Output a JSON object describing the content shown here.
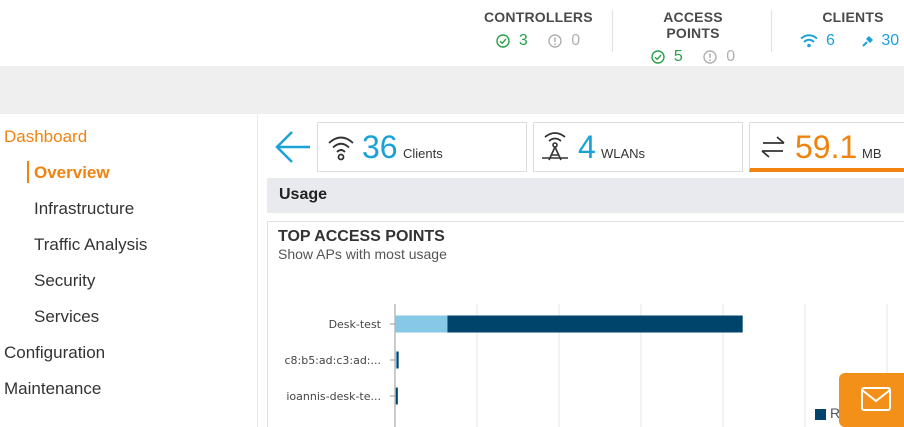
{
  "header": {
    "controllers": {
      "title": "CONTROLLERS",
      "ok": "3",
      "down": "0"
    },
    "access_points": {
      "title": "ACCESS POINTS",
      "ok": "5",
      "down": "0"
    },
    "clients": {
      "title": "CLIENTS",
      "wireless": "6",
      "wired": "30"
    }
  },
  "sidebar": {
    "items": [
      {
        "label": "Dashboard",
        "state": "section-active"
      },
      {
        "label": "Overview",
        "state": "active"
      },
      {
        "label": "Infrastructure"
      },
      {
        "label": "Traffic Analysis"
      },
      {
        "label": "Security"
      },
      {
        "label": "Services"
      },
      {
        "label": "Configuration"
      },
      {
        "label": "Maintenance"
      }
    ]
  },
  "tiles": [
    {
      "value": "36",
      "unit": "Clients",
      "icon": "wifi-icon"
    },
    {
      "value": "4",
      "unit": "WLANs",
      "icon": "access-point-icon"
    },
    {
      "value": "59.1",
      "unit": "MB",
      "icon": "transfer-arrows-icon",
      "selected": true
    }
  ],
  "usage": {
    "label": "Usage"
  },
  "panel": {
    "title": "TOP ACCESS POINTS",
    "subtitle": "Show APs with most usage"
  },
  "chart_data": {
    "type": "bar",
    "orientation": "horizontal",
    "stacked": true,
    "categories": [
      "Desk-test",
      "c8:b5:ad:c3:ad:...",
      "ioannis-desk-te..."
    ],
    "series": [
      {
        "values": [
          3.2,
          0.1,
          0.05
        ],
        "color": "#87c7e8"
      },
      {
        "values": [
          18.0,
          0.05,
          0.1
        ],
        "color": "#00436b"
      }
    ],
    "xlim": [
      0,
      30
    ],
    "grid": true,
    "legend_text": "R"
  },
  "colors": {
    "accent": "#f0830f",
    "brand_blue": "#1aa2d8",
    "ok_green": "#27a048"
  }
}
